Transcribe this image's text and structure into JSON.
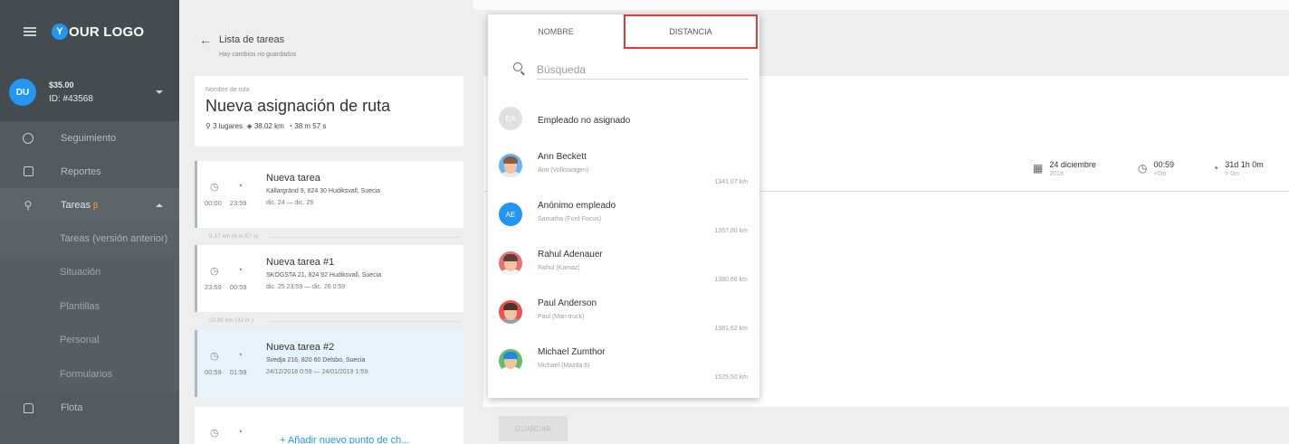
{
  "sidebar": {
    "logo_letter": "Y",
    "logo_text": "OUR LOGO",
    "user": {
      "initials": "DU",
      "balance": "$35.00",
      "id": "ID: #43568"
    },
    "items": [
      {
        "label": "Seguimiento",
        "icon": "globe-icon"
      },
      {
        "label": "Reportes",
        "icon": "chart-icon"
      },
      {
        "label": "Tareas",
        "icon": "pin-icon",
        "badge": "β"
      }
    ],
    "subitems": [
      "Tareas (versión anterior)",
      "Situación",
      "Plantillas",
      "Personal",
      "Formularios"
    ],
    "bottom_item": {
      "label": "Flota",
      "icon": "car-icon"
    }
  },
  "header": {
    "title": "Lista de tareas",
    "subtitle": "Hay cambios no guardados"
  },
  "route": {
    "label": "Nombre de ruta",
    "name": "Nueva asignación de ruta",
    "places": "3 lugares",
    "distance": "38.02 km",
    "duration": "38 m 57 s"
  },
  "tasks": [
    {
      "name": "Nueva tarea",
      "address": "Källargränd 9, 824 30 Hudiksvall, Suecia",
      "time_start": "00:00",
      "time_end": "23:59",
      "dates": "dic. 24 — dic. 29"
    },
    {
      "name": "Nueva tarea #1",
      "address": "SKOGSTA 21, 824 92 Hudiksvall, Suecia",
      "time_start": "23:59",
      "time_end": "00:59",
      "dates": "dic. 25 23:59 — dic. 26 0:59"
    },
    {
      "name": "Nueva tarea #2",
      "address": "Svedja 216, 820 60 Delsbo, Suecia",
      "time_start": "00:59",
      "time_end": "01:59",
      "dates": "24/12/2018 0:59 — 24/01/2019 1:59"
    }
  ],
  "segments": [
    "5.17 km (6 m 57 s)",
    "32.85 km (32 m )"
  ],
  "add_point_label": "+ Añadir nuevo punto de ch...",
  "meta": {
    "date": "24 diciembre",
    "year": "2018",
    "time": "00:59",
    "time_sub": "+0m",
    "duration": "31d 1h 0m",
    "duration_sub": "> 0m"
  },
  "save_label": "GUARDAR",
  "dropdown": {
    "tabs": [
      "NOMBRE",
      "DISTANCIA"
    ],
    "search_placeholder": "Búsqueda",
    "employees": [
      {
        "name": "Empleado no asignado",
        "vehicle": "",
        "distance": "",
        "initials": "EA",
        "avatar_color": "#e0e0e0"
      },
      {
        "name": "Ann Beckett",
        "vehicle": "Ann (Volkswagen)",
        "distance": "1341,07 km",
        "initials": "",
        "avatar_color": "#64b5f6"
      },
      {
        "name": "Anónimo empleado",
        "vehicle": "Samatha (Ford Focus)",
        "distance": "1357,80 km",
        "initials": "AE",
        "avatar_color": "#2196f3"
      },
      {
        "name": "Rahul Adenauer",
        "vehicle": "Rahul (Kamaz)",
        "distance": "1380,66 km",
        "initials": "",
        "avatar_color": "#e57373"
      },
      {
        "name": "Paul Anderson",
        "vehicle": "Paul (Man truck)",
        "distance": "1381,62 km",
        "initials": "",
        "avatar_color": "#ef5350"
      },
      {
        "name": "Michael Zumthor",
        "vehicle": "Michael (Mazda 6)",
        "distance": "1525,50 km",
        "initials": "",
        "avatar_color": "#66bb6a"
      }
    ]
  },
  "colors": {
    "accent": "#2196f3",
    "sidebar": "#525a5e",
    "highlight_border": "#e53935",
    "beta": "#ffb300"
  }
}
